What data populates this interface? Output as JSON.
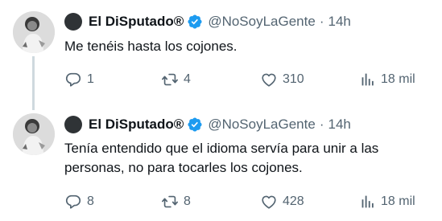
{
  "tweets": [
    {
      "display_name": "El DiSputado®",
      "handle": "@NoSoyLaGente",
      "separator": "·",
      "time": "14h",
      "text": "Me tenéis hasta los cojones.",
      "replies": "1",
      "retweets": "4",
      "likes": "310",
      "views": "18 mil"
    },
    {
      "display_name": "El DiSputado®",
      "handle": "@NoSoyLaGente",
      "separator": "·",
      "time": "14h",
      "text": "Tenía entendido que el idioma servía para unir a las personas, no para tocarles los cojones.",
      "replies": "8",
      "retweets": "8",
      "likes": "428",
      "views": "18 mil"
    }
  ],
  "icons": {
    "verified": "verified-badge-icon",
    "reply": "reply-icon",
    "retweet": "retweet-icon",
    "like": "like-icon",
    "views": "views-icon"
  },
  "colors": {
    "text": "#0f1419",
    "secondary": "#536471",
    "verified": "#1d9bf0",
    "thread_line": "#cfd9de"
  }
}
